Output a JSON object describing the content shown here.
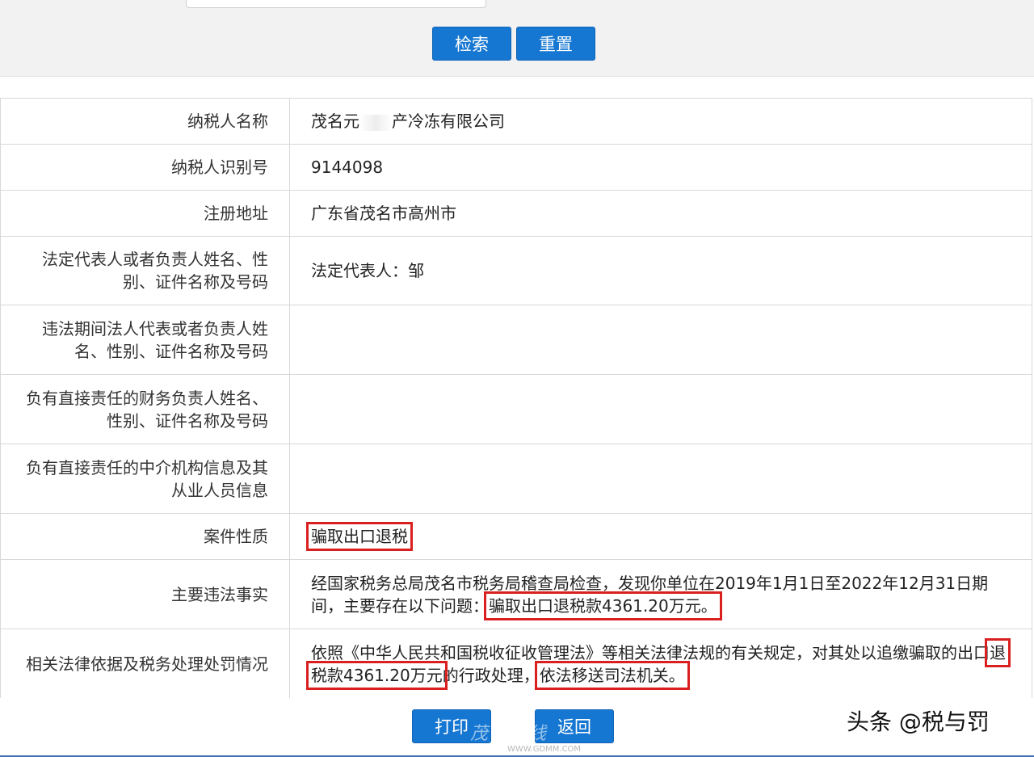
{
  "search": {
    "search_label": "检索",
    "reset_label": "重置"
  },
  "table": {
    "rows": [
      {
        "label": "纳税人名称",
        "value": "茂名元",
        "value_suffix": "产冷冻有限公司"
      },
      {
        "label": "纳税人识别号",
        "value": "9144098"
      },
      {
        "label": "注册地址",
        "value": "广东省茂名市高州市"
      },
      {
        "label": "法定代表人或者负责人姓名、性别、证件名称及号码",
        "value": "法定代表人：邹"
      },
      {
        "label": "违法期间法人代表或者负责人姓名、性别、证件名称及号码",
        "value": ""
      },
      {
        "label": "负有直接责任的财务负责人姓名、性别、证件名称及号码",
        "value": ""
      },
      {
        "label": "负有直接责任的中介机构信息及其从业人员信息",
        "value": ""
      },
      {
        "label": "案件性质",
        "value": "骗取出口退税"
      },
      {
        "label": "主要违法事实",
        "value_part1": "经国家税务总局茂名市税务局稽查局检查，发现你单位在2019年1月1日至2022年12月31日期间，主要存在以下问题：",
        "value_highlight": "骗取出口退税款4361.20万元。"
      },
      {
        "label": "相关法律依据及税务处理处罚情况",
        "value_part1": "依照《中华人民共和国税收征收管理法》等相关法律法规的有关规定，对其处以追缴骗取的出口",
        "value_highlight1": "退税款4361.20万元",
        "value_part2": "的行政处理，",
        "value_highlight2": "依法移送司法机关。"
      }
    ]
  },
  "footer": {
    "print_label": "打印",
    "back_label": "返回"
  },
  "watermark": {
    "text": "茂名在线",
    "url": "WWW.GDMM.COM"
  },
  "credit": "头条 @税与罚"
}
